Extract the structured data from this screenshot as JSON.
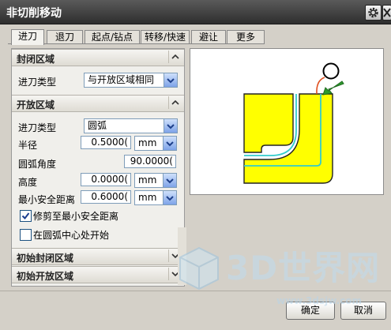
{
  "window": {
    "title": "非切削移动"
  },
  "tabs": [
    {
      "label": "进刀",
      "active": true
    },
    {
      "label": "退刀",
      "active": false
    },
    {
      "label": "起点/钻点",
      "active": false
    },
    {
      "label": "转移/快速",
      "active": false
    },
    {
      "label": "避让",
      "active": false
    },
    {
      "label": "更多",
      "active": false
    }
  ],
  "closed_region": {
    "header": "封闭区域",
    "entry_type_label": "进刀类型",
    "entry_type_value": "与开放区域相同"
  },
  "open_region": {
    "header": "开放区域",
    "entry_type_label": "进刀类型",
    "entry_type_value": "圆弧",
    "radius_label": "半径",
    "radius_value": "0.5000(",
    "radius_unit": "mm",
    "arc_angle_label": "圆弧角度",
    "arc_angle_value": "90.0000(",
    "height_label": "高度",
    "height_value": "0.0000(",
    "height_unit": "mm",
    "min_clearance_label": "最小安全距离",
    "min_clearance_value": "0.6000(",
    "min_clearance_unit": "mm",
    "trim_label": "修剪至最小安全距离",
    "trim_checked": true,
    "arc_center_label": "在圆弧中心处开始",
    "arc_center_checked": false
  },
  "initial_closed": {
    "header": "初始封闭区域"
  },
  "initial_open": {
    "header": "初始开放区域"
  },
  "footer": {
    "ok_label": "确定",
    "cancel_label": "取消"
  },
  "watermark": {
    "brand": "3D世界网",
    "url": "www.3dsjw.com"
  },
  "colors": {
    "titlebar": "#3c3c3c",
    "preview_fill": "#ffff00",
    "toolpath": "#33cccc",
    "arrow": "#2e9a2e",
    "lead_arc": "#e05020"
  }
}
